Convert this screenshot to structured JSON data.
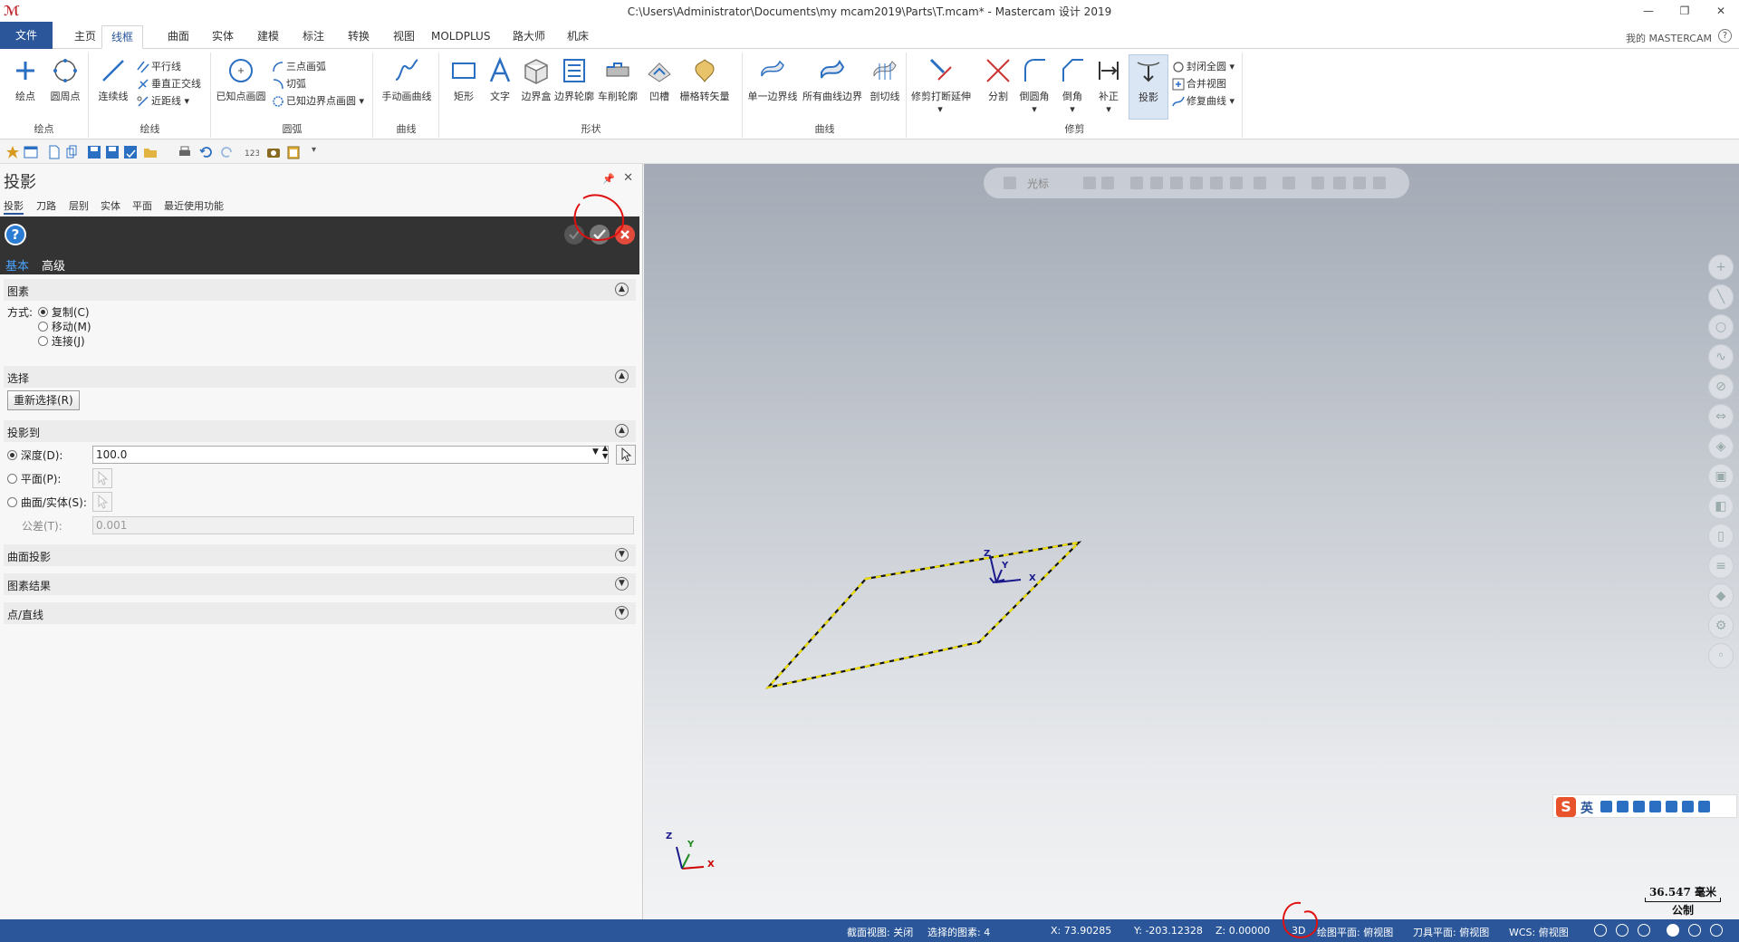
{
  "window": {
    "title": "C:\\Users\\Administrator\\Documents\\my mcam2019\\Parts\\T.mcam* - Mastercam 设计 2019"
  },
  "ribbon_tabs": [
    "文件",
    "主页",
    "线框",
    "曲面",
    "实体",
    "建模",
    "标注",
    "转换",
    "视图",
    "MOLDPLUS",
    "路大师",
    "机床"
  ],
  "active_tab": "线框",
  "account_label": "我的 MASTERCAM",
  "ribbon": {
    "groups": {
      "points": "绘点",
      "lines": "绘线",
      "arcs": "圆弧",
      "curves": "曲线",
      "shapes": "形状",
      "curves2": "曲线",
      "modify": "修剪"
    },
    "buttons": {
      "point": "绘点",
      "circle_point": "圆周点",
      "endpoint_line": "连续线",
      "parallel": "平行线",
      "perpendicular": "垂直正交线",
      "closest": "近距线",
      "circle_center": "已知点画圆",
      "arc3": "三点画弧",
      "tangent": "切弧",
      "circle_edge": "已知边界点画圆",
      "manual_spline": "手动画曲线",
      "rectangle": "矩形",
      "text": "文字",
      "bounding_box": "边界盒",
      "boundary_profile": "边界轮廓",
      "turn_profile": "车削轮廓",
      "groove": "凹槽",
      "grille": "栅格转矢量",
      "single_edge": "单一边界线",
      "all_edges": "所有曲线边界",
      "slice": "剖切线",
      "trim_break": "修剪打断延伸",
      "divide": "分割",
      "fillet": "倒圆角",
      "chamfer": "倒角",
      "offset": "补正",
      "project": "投影",
      "close_arc": "封闭全圆",
      "join_view": "合并视图",
      "repair_curve": "修复曲线"
    }
  },
  "panel": {
    "title": "投影",
    "tabs": [
      "投影",
      "刀路",
      "层别",
      "实体",
      "平面",
      "最近使用功能"
    ],
    "subtabs": [
      "基本",
      "高级"
    ],
    "sections": {
      "entities": {
        "title": "图素",
        "method_label": "方式:",
        "options": [
          "复制(C)",
          "移动(M)",
          "连接(J)"
        ],
        "selected": "复制(C)"
      },
      "selection": {
        "title": "选择",
        "reselect_label": "重新选择(R)"
      },
      "project_to": {
        "title": "投影到",
        "depth_label": "深度(D):",
        "depth_value": "100.0",
        "plane_label": "平面(P):",
        "surface_label": "曲面/实体(S):",
        "tolerance_label": "公差(T):",
        "tolerance_value": "0.001"
      },
      "surface_projection": "曲面投影",
      "entity_result": "图素结果",
      "point_line": "点/直线"
    }
  },
  "viewport": {
    "toolbar_text": "光标",
    "gnomon_x": "X",
    "gnomon_y": "Y",
    "gnomon_z": "Z",
    "ime_lang": "英",
    "scale_value": "36.547 毫米",
    "scale_unit": "公制",
    "colors": {
      "selection": "#f0e000",
      "axis_x": "#cc0000",
      "axis_y": "#1e8a1e",
      "axis_z": "#1a1a8c"
    }
  },
  "statusbar": {
    "section_view": "截面视图: 关闭",
    "selected": "选择的图素: 4",
    "x": "X:   73.90285",
    "y": "Y:   -203.12328",
    "z": "Z:   0.00000",
    "mode": "3D",
    "draw_plane": "绘图平面: 俯视图",
    "tool_plane": "刀具平面: 俯视图",
    "wcs": "WCS: 俯视图"
  }
}
